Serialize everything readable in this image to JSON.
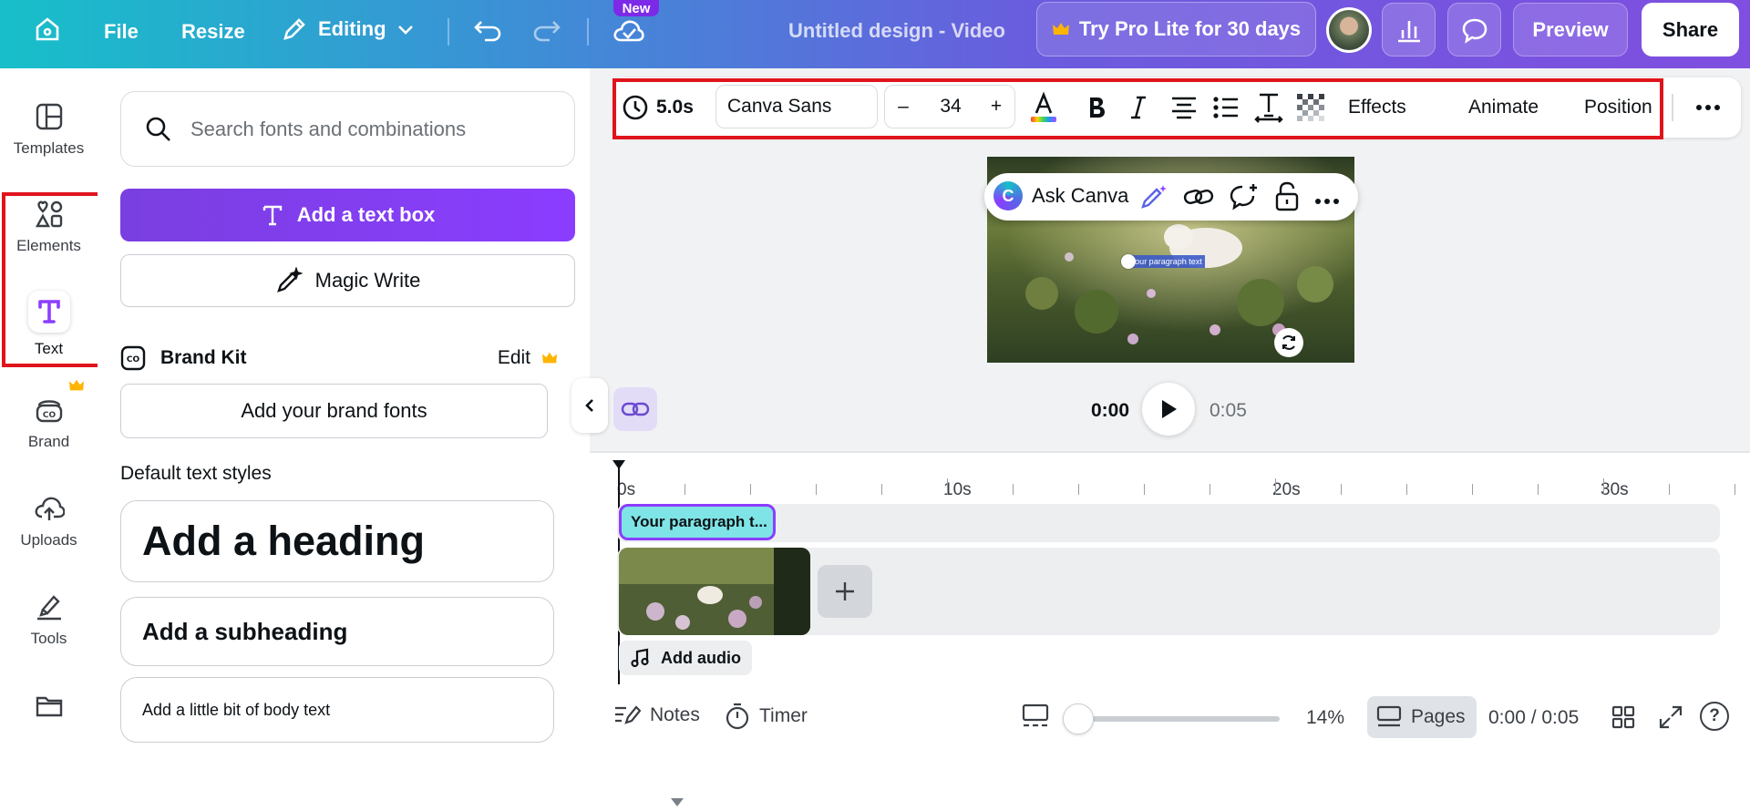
{
  "topbar": {
    "file": "File",
    "resize": "Resize",
    "editing": "Editing",
    "new_badge": "New",
    "title": "Untitled design - Video",
    "pro": "Try Pro Lite for 30 days",
    "preview": "Preview",
    "share": "Share"
  },
  "rail": {
    "templates": "Templates",
    "elements": "Elements",
    "text": "Text",
    "brand": "Brand",
    "uploads": "Uploads",
    "tools": "Tools"
  },
  "panel": {
    "search_placeholder": "Search fonts and combinations",
    "add_text_box": "Add a text box",
    "magic_write": "Magic Write",
    "brand_kit": "Brand Kit",
    "edit": "Edit",
    "brand_fonts": "Add your brand fonts",
    "default_styles": "Default text styles",
    "heading": "Add a heading",
    "subheading": "Add a subheading",
    "body": "Add a little bit of body text"
  },
  "toolbar": {
    "duration": "5.0s",
    "font": "Canva Sans",
    "size": "34",
    "minus": "–",
    "plus": "+",
    "effects": "Effects",
    "animate": "Animate",
    "position": "Position"
  },
  "canvas": {
    "ask": "Ask Canva",
    "selected_text": "Your paragraph text"
  },
  "playback": {
    "current": "0:00",
    "total": "0:05"
  },
  "timeline": {
    "ticks": [
      "0s",
      "10s",
      "20s",
      "30s"
    ],
    "text_clip": "Your paragraph t...",
    "add_audio": "Add audio"
  },
  "bottom": {
    "notes": "Notes",
    "timer": "Timer",
    "zoom": "14%",
    "pages": "Pages",
    "time": "0:00 / 0:05",
    "help": "?"
  },
  "colors": {
    "accent": "#8b3dff",
    "highlight": "#e0141c",
    "clip_teal": "#7fe4e6"
  }
}
